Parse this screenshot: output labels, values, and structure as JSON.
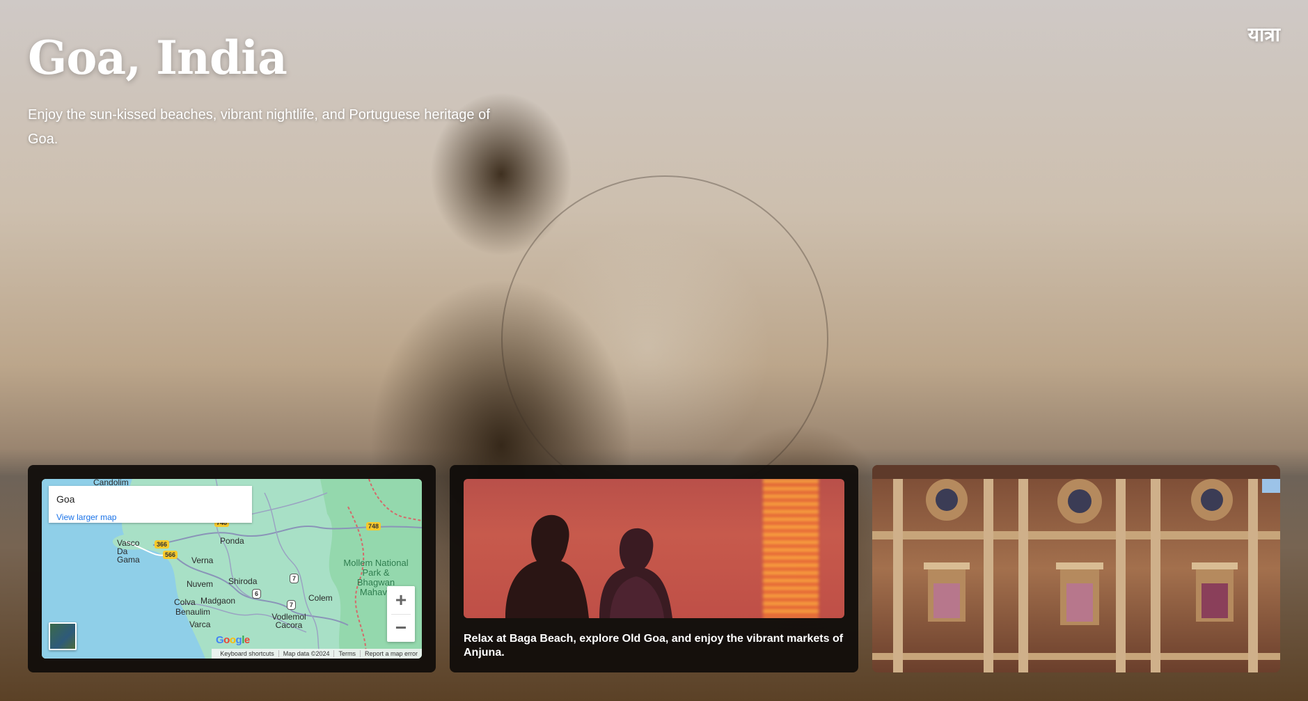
{
  "hero": {
    "title": "Goa, India",
    "subtitle": "Enjoy the sun-kissed beaches, vibrant nightlife, and Portuguese heritage of Goa."
  },
  "brand": {
    "logo_text": "यात्रा"
  },
  "map_card": {
    "info_title": "Goa",
    "info_link": "View larger map",
    "places": [
      "Candolim",
      "Vasco Da Gama",
      "Ponda",
      "Verna",
      "Nuvem",
      "Shiroda",
      "Colva",
      "Madgaon",
      "Benaulim",
      "Colem",
      "Varca",
      "Vodlemol Cacora",
      "Mollem National Park & Bhagwan Mahavir"
    ],
    "road_shields": [
      "748",
      "748",
      "366",
      "566",
      "7",
      "6",
      "7"
    ],
    "zoom_in": "+",
    "zoom_out": "−",
    "google_logo": "Google",
    "attribution": [
      "Keyboard shortcuts",
      "Map data ©2024",
      "Terms",
      "Report a map error"
    ],
    "colors": {
      "water": "#8fcfe8",
      "land": "#a8e0c6",
      "park": "#8ed6a6",
      "link": "#1a73e8"
    }
  },
  "sunset_card": {
    "caption": "Relax at Baga Beach, explore Old Goa, and enjoy the vibrant markets of Anjuna.",
    "image_alt": "silhouette of two people at sunset"
  },
  "church_card": {
    "image_alt": "facade of a Portuguese church in Old Goa"
  }
}
